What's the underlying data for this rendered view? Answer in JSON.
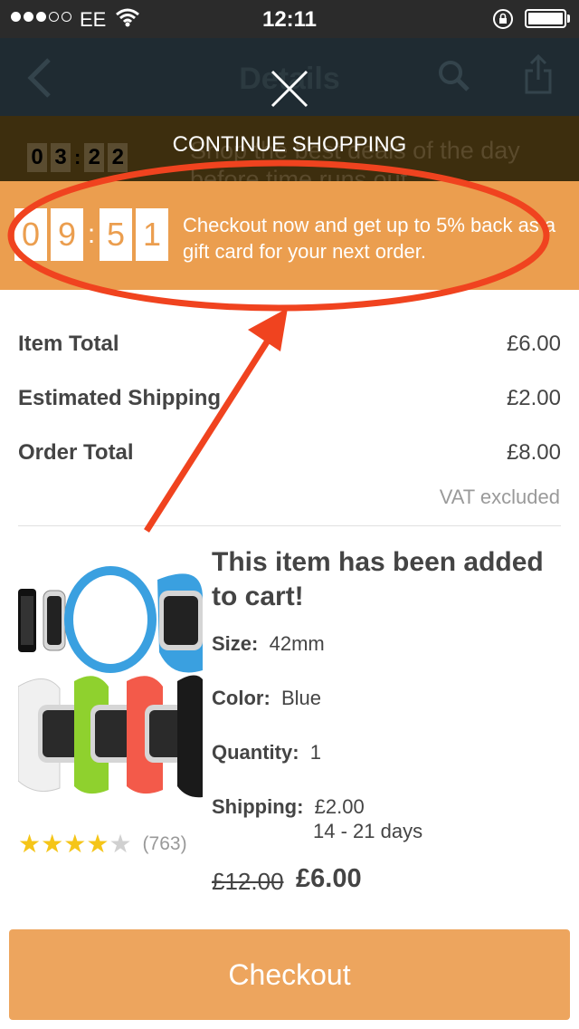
{
  "status_bar": {
    "carrier": "EE",
    "time": "12:11",
    "signal_filled": 3,
    "signal_total": 5,
    "battery_level": 1.0
  },
  "nav": {
    "title": "Details"
  },
  "deal_banner": {
    "digits": [
      "0",
      "3",
      "2",
      "2"
    ],
    "text": "Shop the best deals of the day before time runs out"
  },
  "overlay": {
    "continue_label": "CONTINUE SHOPPING"
  },
  "promo": {
    "timer_digits": [
      "0",
      "9",
      "5",
      "1"
    ],
    "text": "Checkout now and get up to 5% back as a gift card for your next order."
  },
  "totals": {
    "item_total_label": "Item Total",
    "item_total_value": "£6.00",
    "shipping_label": "Estimated Shipping",
    "shipping_value": "£2.00",
    "order_total_label": "Order Total",
    "order_total_value": "£8.00",
    "vat_note": "VAT excluded"
  },
  "product": {
    "added_title": "This item has been added to cart!",
    "size_label": "Size:",
    "size_value": "42mm",
    "color_label": "Color:",
    "color_value": "Blue",
    "quantity_label": "Quantity:",
    "quantity_value": "1",
    "shipping_label": "Shipping:",
    "shipping_value": "£2.00",
    "shipping_days": "14 - 21 days",
    "old_price": "£12.00",
    "new_price": "£6.00",
    "rating_stars": 4,
    "rating_max": 5,
    "review_count": "(763)"
  },
  "checkout_label": "Checkout",
  "colors": {
    "orange": "#eb9e4f",
    "button": "#eda55e",
    "annotation_red": "#f0431f",
    "star": "#f5c518"
  }
}
